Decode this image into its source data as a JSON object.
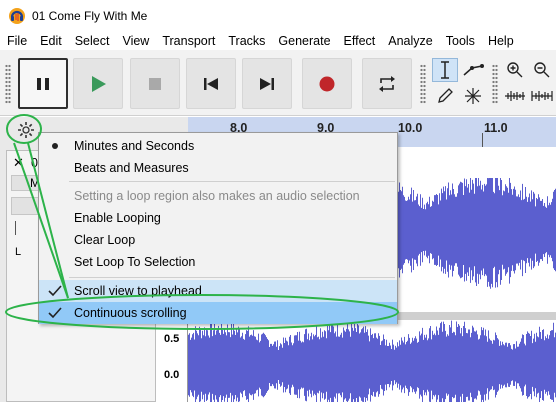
{
  "window": {
    "title": "01 Come Fly With Me"
  },
  "menubar": {
    "items": [
      "File",
      "Edit",
      "Select",
      "View",
      "Transport",
      "Tracks",
      "Generate",
      "Effect",
      "Analyze",
      "Tools",
      "Help"
    ]
  },
  "toolbar": {
    "buttons": [
      {
        "name": "pause-button",
        "icon": "pause-icon",
        "active": true
      },
      {
        "name": "play-button",
        "icon": "play-icon",
        "color": "#3a9a5b"
      },
      {
        "name": "stop-button",
        "icon": "stop-icon"
      },
      {
        "name": "skip-to-start-button",
        "icon": "skip-start-icon"
      },
      {
        "name": "skip-to-end-button",
        "icon": "skip-end-icon"
      },
      {
        "name": "record-button",
        "icon": "record-icon",
        "color": "#c0262a"
      },
      {
        "name": "loop-button",
        "icon": "loop-icon"
      }
    ],
    "tools": [
      "selection-tool",
      "envelope-tool",
      "draw-tool",
      "multi-tool",
      "zoom-in",
      "zoom-out",
      "fit-selection",
      "fit-project"
    ]
  },
  "timeline": {
    "ticks": [
      "8.0",
      "9.0",
      "10.0",
      "11.0"
    ]
  },
  "track": {
    "name_visible": "0",
    "scale_labels": [
      "0.5",
      "0.0"
    ]
  },
  "popup": {
    "items": [
      {
        "label": "Minutes and Seconds",
        "mark": "bullet",
        "state": "normal"
      },
      {
        "label": "Beats and Measures",
        "mark": "",
        "state": "normal"
      },
      {
        "label": "Setting a loop region also makes an audio selection",
        "mark": "",
        "state": "disabled"
      },
      {
        "label": "Enable Looping",
        "mark": "",
        "state": "normal"
      },
      {
        "label": "Clear Loop",
        "mark": "",
        "state": "normal"
      },
      {
        "label": "Set Loop To Selection",
        "mark": "",
        "state": "normal"
      },
      {
        "label": "Scroll view to playhead",
        "mark": "check",
        "state": "checked"
      },
      {
        "label": "Continuous scrolling",
        "mark": "check",
        "state": "highlight"
      }
    ]
  },
  "colors": {
    "wave": "#5b5fcf",
    "ruler": "#c9d6f0",
    "annotation": "#2db34a",
    "menu_highlight": "#91c9f7"
  }
}
